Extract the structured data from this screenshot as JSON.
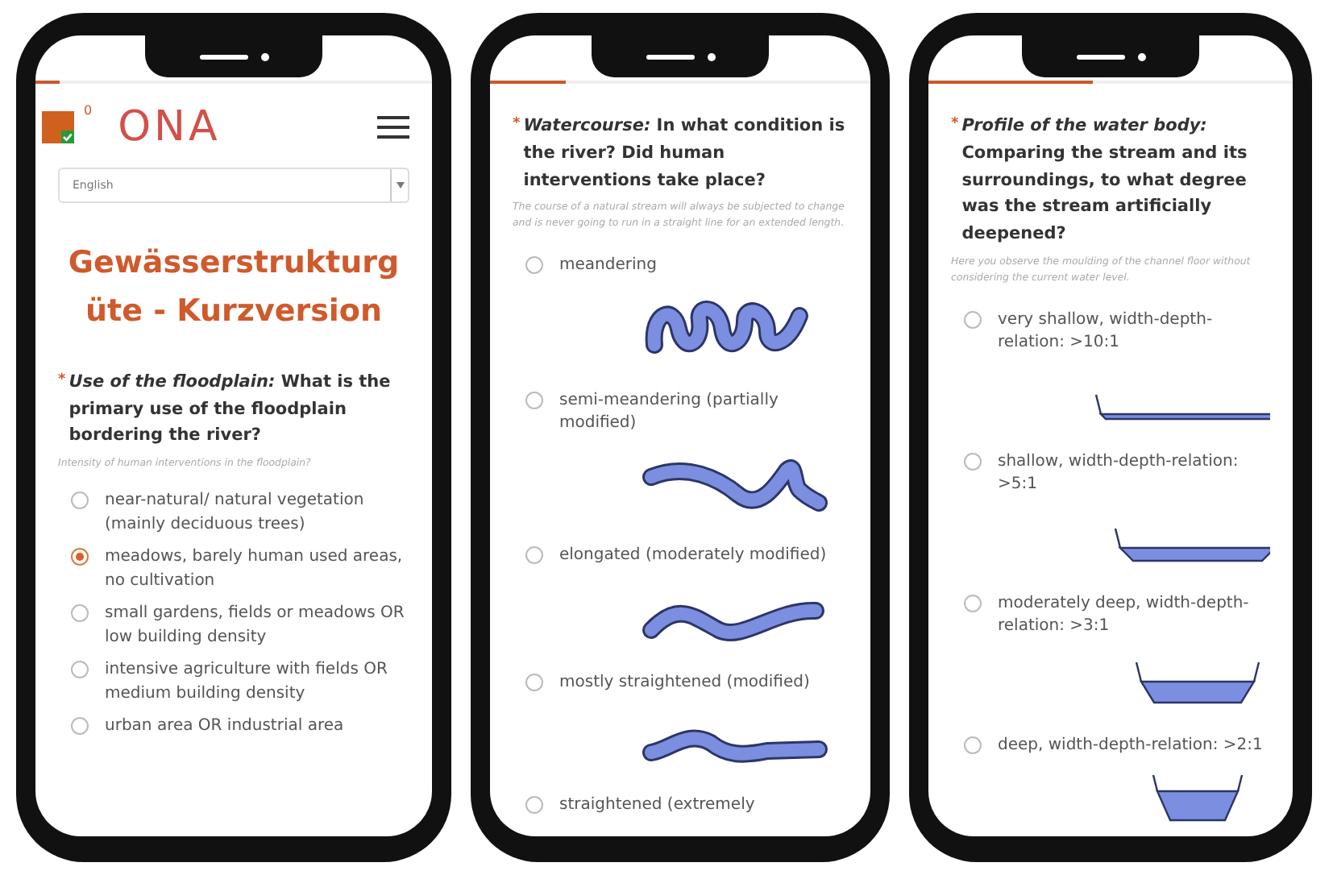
{
  "phones": [
    {
      "progress": {
        "level": 0.06
      },
      "header": {
        "badge": "0",
        "logo": "ONA"
      },
      "language": "English",
      "title": "Gewässerstrukturgüte - Kurzversion",
      "question": {
        "required_mark": "*",
        "text": "*Use of the floodplain:* What is the primary use of the floodplain bordering the river?",
        "hint": "Intensity of human interventions in the floodplain?"
      },
      "options": [
        {
          "label": "near-natural/ natural vegetation (mainly deciduous trees)",
          "selected": false
        },
        {
          "label": "meadows, barely human used areas, no cultivation",
          "selected": true
        },
        {
          "label": "small gardens, fields or meadows OR low building density",
          "selected": false
        },
        {
          "label": "intensive agriculture with fields OR medium building density",
          "selected": false
        },
        {
          "label": "urban area OR industrial area",
          "selected": false
        }
      ]
    },
    {
      "progress": {
        "level": 0.2
      },
      "question": {
        "required_mark": "*",
        "text": "*Watercourse:* In what condition is the river? Did human interventions take place?",
        "hint": "The course of a natural stream will always be subjected to change and is never going to run in a straight line for an extended length."
      },
      "options": [
        {
          "label": "meandering",
          "selected": false,
          "kind": "meander"
        },
        {
          "label": "semi-meandering (partially modified)",
          "selected": false,
          "kind": "semi-meander"
        },
        {
          "label": "elongated (moderately modified)",
          "selected": false,
          "kind": "elongated"
        },
        {
          "label": "mostly straightened (modified)",
          "selected": false,
          "kind": "straightened"
        },
        {
          "label": "straightened (extremely",
          "selected": false
        }
      ]
    },
    {
      "progress": {
        "level": 0.45
      },
      "question": {
        "required_mark": "*",
        "text": "*Profile of the water body:* Comparing the stream and its surroundings, to what degree was the stream artificially deepened?",
        "hint": "Here you observe the moulding of the channel floor without considering the current water level."
      },
      "options": [
        {
          "label": "very shallow, width-depth-relation: >10:1",
          "selected": false,
          "kind": "profile-very-shallow"
        },
        {
          "label": "shallow, width-depth-relation: >5:1",
          "selected": false,
          "kind": "profile-shallow"
        },
        {
          "label": "moderately deep, width-depth-relation: >3:1",
          "selected": false,
          "kind": "profile-moderate"
        },
        {
          "label": "deep, width-depth-relation: >2:1",
          "selected": false,
          "kind": "profile-deep"
        }
      ]
    }
  ]
}
